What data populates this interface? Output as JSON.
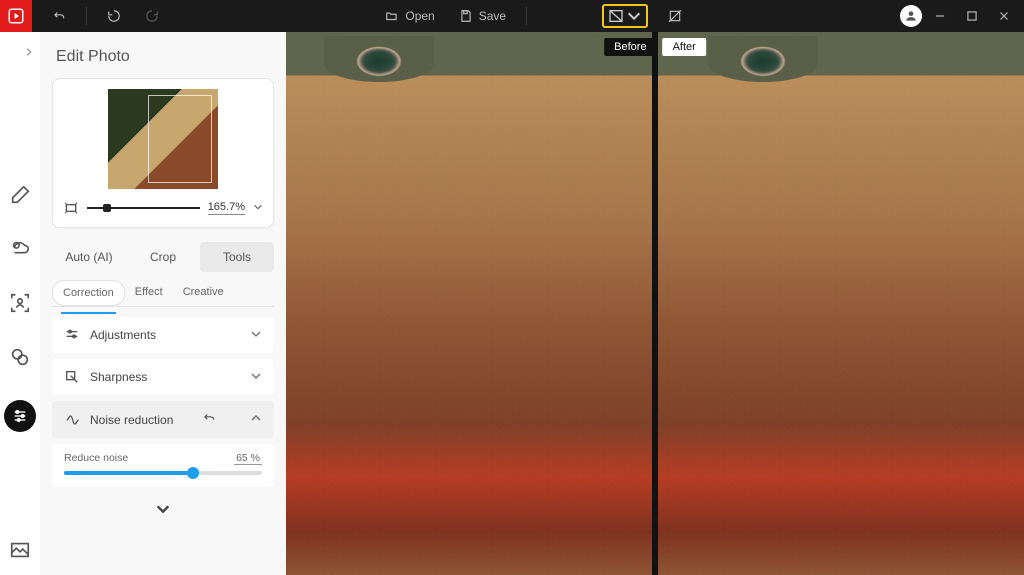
{
  "topbar": {
    "open_label": "Open",
    "save_label": "Save"
  },
  "panel": {
    "title": "Edit Photo",
    "zoom_value": "165.7%",
    "tabs": {
      "auto": "Auto (AI)",
      "crop": "Crop",
      "tools": "Tools"
    },
    "subtabs": {
      "correction": "Correction",
      "effect": "Effect",
      "creative": "Creative"
    },
    "accordion": {
      "adjustments": "Adjustments",
      "sharpness": "Sharpness",
      "noise_reduction": "Noise reduction",
      "reduce_noise_label": "Reduce noise",
      "reduce_noise_value": "65 %"
    }
  },
  "canvas": {
    "before": "Before",
    "after": "After"
  }
}
